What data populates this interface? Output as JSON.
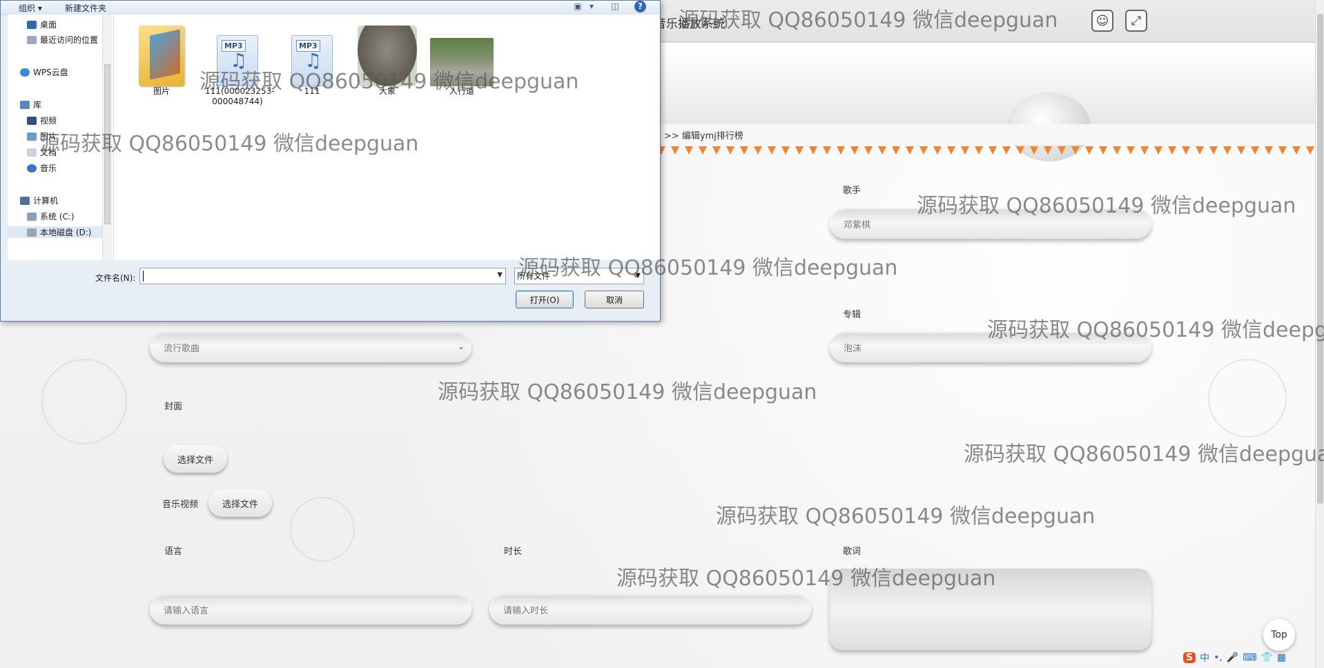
{
  "app": {
    "title": "音乐播放系统",
    "breadcrumb": ">> 编辑ymj排行榜",
    "user_icon": "user-icon",
    "fullscreen_icon": "fullscreen-icon"
  },
  "form": {
    "singer_label": "歌手",
    "singer_value": "邓紫棋",
    "album_label": "专辑",
    "album_value": "泡沫",
    "category_selected": "流行歌曲",
    "cover_label": "封面",
    "cover_button": "选择文件",
    "video_label": "音乐视频",
    "video_button": "选择文件",
    "language_label": "语言",
    "language_placeholder": "请输入语言",
    "duration_label": "时长",
    "duration_placeholder": "请输入时长",
    "lyrics_label": "歌词",
    "top_button": "Top"
  },
  "dialog": {
    "toolbar": {
      "organize": "组织 ▾",
      "new_folder": "新建文件夹"
    },
    "nav": [
      {
        "label": "桌面"
      },
      {
        "label": "最近访问的位置"
      },
      {
        "label": "WPS云盘"
      },
      {
        "label": "库"
      },
      {
        "label": "视频"
      },
      {
        "label": "图片"
      },
      {
        "label": "文档"
      },
      {
        "label": "音乐"
      },
      {
        "label": "计算机"
      },
      {
        "label": "系统 (C:)"
      },
      {
        "label": "本地磁盘 (D:)"
      }
    ],
    "files": [
      {
        "name": "图片",
        "icon": "folder-icon"
      },
      {
        "name": "111(000023253-000048744)",
        "icon": "mp3-file-icon"
      },
      {
        "name": "111",
        "icon": "mp3-file-icon"
      },
      {
        "name": "大象",
        "icon": "image-thumbnail"
      },
      {
        "name": "人行道",
        "icon": "image-thumbnail"
      }
    ],
    "filename_label": "文件名(N):",
    "filename_value": "",
    "filetype_selected": "所有文件",
    "open_button": "打开(O)",
    "cancel_button": "取消"
  },
  "ime": {
    "logo": "S",
    "mode": "中"
  },
  "watermark": "源码获取 QQ86050149 微信deepguan"
}
